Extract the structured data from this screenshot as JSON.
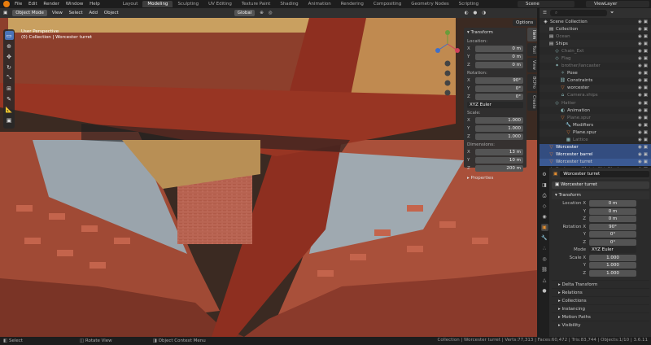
{
  "topbar": {
    "menus": [
      "File",
      "Edit",
      "Render",
      "Window",
      "Help"
    ],
    "workspaces": [
      "Layout",
      "Modeling",
      "Sculpting",
      "UV Editing",
      "Texture Paint",
      "Shading",
      "Animation",
      "Rendering",
      "Compositing",
      "Geometry Nodes",
      "Scripting"
    ],
    "active_workspace": "Modeling",
    "scene": "Scene",
    "view_layer": "ViewLayer"
  },
  "viewport_header": {
    "mode": "Object Mode",
    "menus": [
      "View",
      "Select",
      "Add",
      "Object"
    ],
    "transform_orientation": "Global",
    "options": "Options"
  },
  "viewport": {
    "perspective": "User Perspective",
    "collection_label": "(0) Collection | Worcester turret"
  },
  "npanel": {
    "tabs": [
      "Item",
      "Tool",
      "View",
      "BCPro",
      "Create"
    ],
    "header": "Transform",
    "location_label": "Location:",
    "location": {
      "x": "0 m",
      "y": "0 m",
      "z": "0 m"
    },
    "rotation_label": "Rotation:",
    "rotation": {
      "x": "90°",
      "y": "0°",
      "z": "0°"
    },
    "rotation_mode": "XYZ Euler",
    "scale_label": "Scale:",
    "scale": {
      "x": "1.000",
      "y": "1.000",
      "z": "1.000"
    },
    "dimensions_label": "Dimensions:",
    "dimensions": {
      "x": "13 m",
      "y": "10 m",
      "z": "200 m"
    },
    "properties": "Properties"
  },
  "outliner": {
    "search_placeholder": "",
    "items": [
      {
        "name": "Scene Collection",
        "depth": 0,
        "icon": "scene-collection-icon"
      },
      {
        "name": "Collection",
        "depth": 1,
        "icon": "collection-icon"
      },
      {
        "name": "Ocean",
        "depth": 1,
        "icon": "collection-icon",
        "dim": true
      },
      {
        "name": "Ships",
        "depth": 1,
        "icon": "collection-icon"
      },
      {
        "name": "Chain_Ext",
        "depth": 2,
        "icon": "object-icon",
        "dim": true
      },
      {
        "name": "Flag",
        "depth": 2,
        "icon": "object-icon",
        "dim": true
      },
      {
        "name": "brother/lancaster",
        "depth": 2,
        "icon": "armature-icon",
        "dim": true
      },
      {
        "name": "Pose",
        "depth": 3,
        "icon": "pose-icon"
      },
      {
        "name": "Constraints",
        "depth": 3,
        "icon": "constraint-icon"
      },
      {
        "name": "worcester",
        "depth": 3,
        "icon": "mesh-icon"
      },
      {
        "name": "Camera.ships",
        "depth": 3,
        "icon": "camera-icon",
        "dim": true
      },
      {
        "name": "Hatter",
        "depth": 2,
        "icon": "object-icon",
        "dim": true
      },
      {
        "name": "Animation",
        "depth": 3,
        "icon": "animation-icon"
      },
      {
        "name": "Plane.spur",
        "depth": 3,
        "icon": "mesh-icon",
        "dim": true
      },
      {
        "name": "Modifiers",
        "depth": 4,
        "icon": "wrench-icon"
      },
      {
        "name": "Plane.spur",
        "depth": 4,
        "icon": "mesh-icon"
      },
      {
        "name": "Lattice",
        "depth": 4,
        "icon": "lattice-icon",
        "dim": true
      },
      {
        "name": "Worcester",
        "depth": 1,
        "icon": "mesh-icon",
        "sel": true
      },
      {
        "name": "Worcester barrel",
        "depth": 1,
        "icon": "mesh-icon",
        "sel": true
      },
      {
        "name": "Worcester turret",
        "depth": 1,
        "icon": "mesh-icon",
        "hl": true
      },
      {
        "name": "BackgroundMatrix.ShipBlocks",
        "depth": 1,
        "icon": "object-icon",
        "dim": true
      }
    ]
  },
  "properties": {
    "object_name": "Worcester turret",
    "object_block": "Worcester turret",
    "transform_header": "Transform",
    "rows": [
      {
        "label": "Location X",
        "value": "0 m"
      },
      {
        "label": "Y",
        "value": "0 m"
      },
      {
        "label": "Z",
        "value": "0 m"
      },
      {
        "label": "Rotation X",
        "value": "90°"
      },
      {
        "label": "Y",
        "value": "0°"
      },
      {
        "label": "Z",
        "value": "0°"
      }
    ],
    "mode_label": "Mode",
    "mode_value": "XYZ Euler",
    "scale_rows": [
      {
        "label": "Scale X",
        "value": "1.000"
      },
      {
        "label": "Y",
        "value": "1.000"
      },
      {
        "label": "Z",
        "value": "1.000"
      }
    ],
    "sections": [
      "Delta Transform",
      "Relations",
      "Collections",
      "Instancing",
      "Motion Paths",
      "Visibility"
    ]
  },
  "statusbar": {
    "select": "Select",
    "rotate": "Rotate View",
    "context": "Object Context Menu",
    "stats": "Collection | Worcester turret | Verts:77,313 | Faces:60,472 | Tris:83,744 | Objects:1/10 | 3.6.11"
  }
}
